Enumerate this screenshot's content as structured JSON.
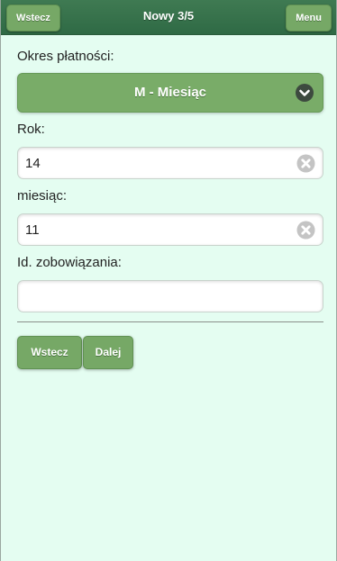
{
  "header": {
    "back_label": "Wstecz",
    "title": "Nowy 3/5",
    "menu_label": "Menu"
  },
  "form": {
    "payment_period": {
      "label": "Okres płatności:",
      "selected": "M - Miesiąc"
    },
    "year": {
      "label": "Rok:",
      "value": "14"
    },
    "month": {
      "label": "miesiąc:",
      "value": "11"
    },
    "obligation_id": {
      "label": "Id. zobowiązania:",
      "value": ""
    }
  },
  "actions": {
    "back_label": "Wstecz",
    "next_label": "Dalej"
  },
  "colors": {
    "header_bg": "#2f6a45",
    "button_bg": "#76a866",
    "page_bg": "#e4fdf1"
  }
}
